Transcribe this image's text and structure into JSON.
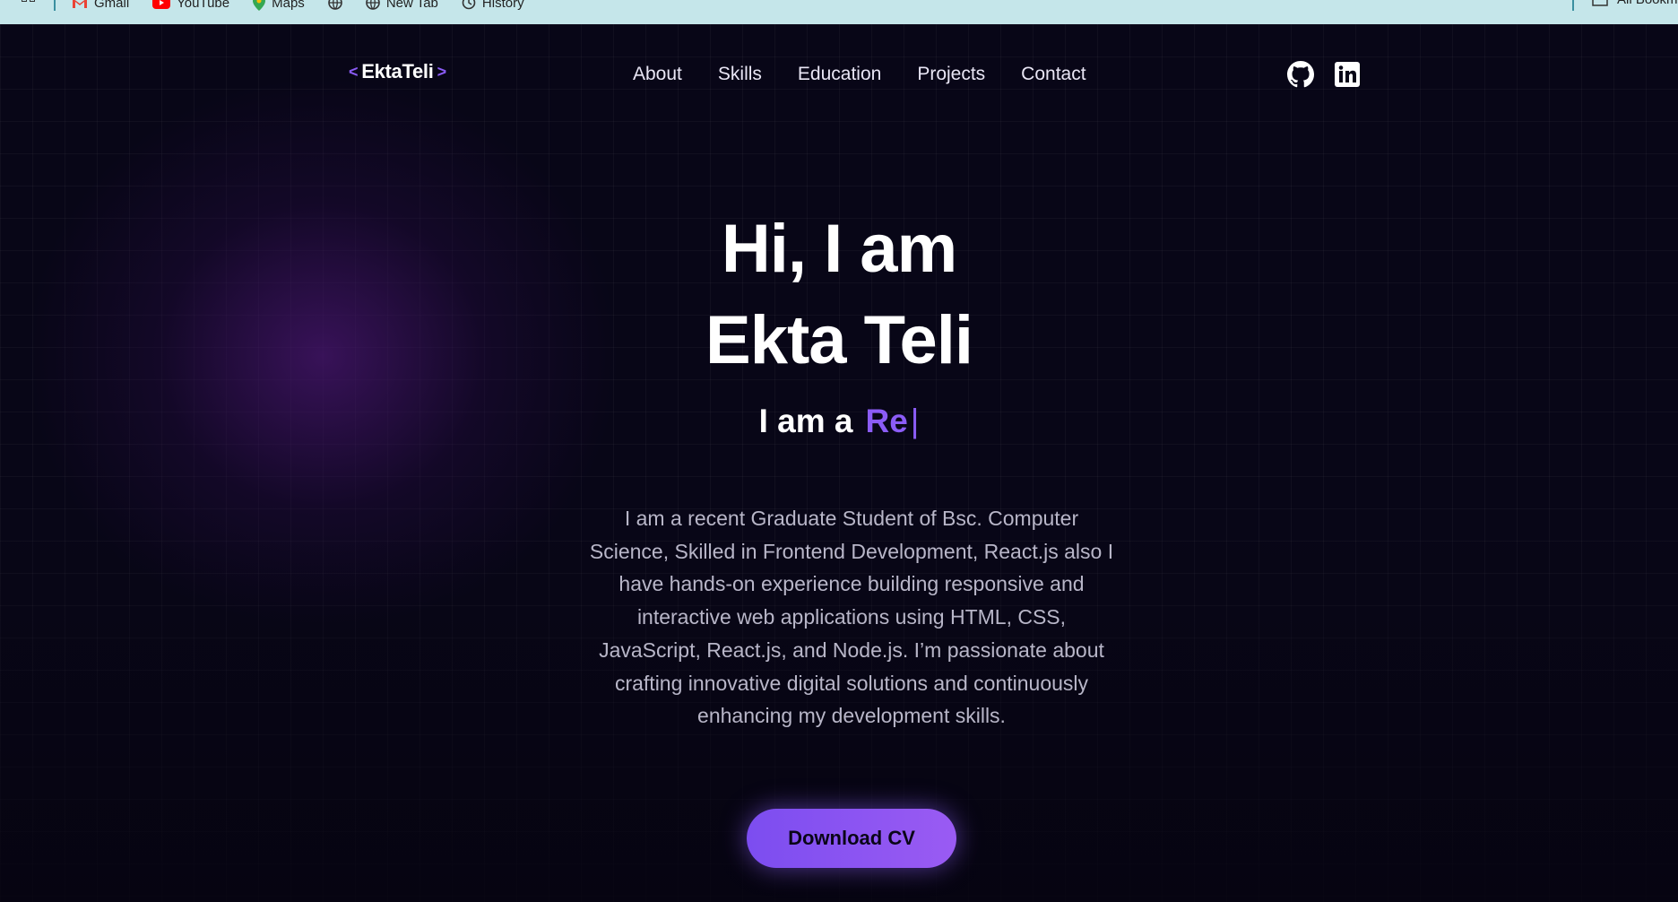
{
  "bookmarks": {
    "items": [
      "Gmail",
      "YouTube",
      "Maps",
      "",
      "New Tab",
      "History"
    ],
    "right_label": "All Bookmarks"
  },
  "nav": {
    "logo_open": "<",
    "logo_text": "EktaTeli",
    "logo_close": ">",
    "links": [
      "About",
      "Skills",
      "Education",
      "Projects",
      "Contact"
    ],
    "social_icons": [
      "github-icon",
      "linkedin-icon"
    ]
  },
  "hero": {
    "line1": "Hi, I am",
    "line2": "Ekta Teli",
    "typed_prefix": "I am a",
    "typed_role": "Re",
    "typed_cursor": "|",
    "description": "I am a recent Graduate Student of Bsc. Computer Science, Skilled in Frontend Development, React.js also I have hands-on experience building responsive and interactive web applications using HTML, CSS, JavaScript, React.js, and Node.js. I’m passionate about crafting innovative digital solutions and continuously enhancing my development skills.",
    "cta_label": "Download CV"
  },
  "colors": {
    "accent": "#8b5cf6",
    "background": "#080617",
    "text": "#ffffff",
    "muted_text": "#b8b6c8"
  }
}
